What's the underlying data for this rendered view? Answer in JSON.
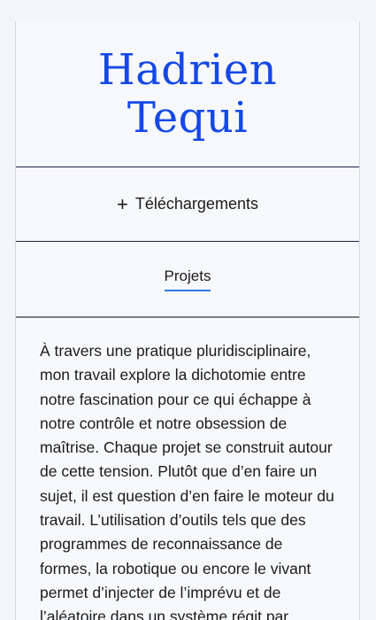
{
  "site": {
    "title": "Hadrien Tequi"
  },
  "menu": {
    "downloads_label": "Téléchargements"
  },
  "nav": {
    "projects_label": "Projets"
  },
  "content": {
    "intro": "À travers une pratique pluridisciplinaire, mon travail explore la dichotomie entre notre fascination pour ce qui échappe à notre contrôle et notre obsession de maîtrise. Chaque projet se construit autour de cette tension. Plutôt que d’en faire un sujet, il est question d’en faire le moteur du travail. L’utilisation d’outils tels que des programmes de reconnaissance de formes, la robotique ou encore le vivant permet d’injecter de l’imprévu et de l’aléatoire dans un système régit par"
  },
  "colors": {
    "title": "#1448e6",
    "accent_underline": "#2d7be0",
    "divider": "#1d2440"
  },
  "icons": {
    "downloads": "plus-icon"
  }
}
